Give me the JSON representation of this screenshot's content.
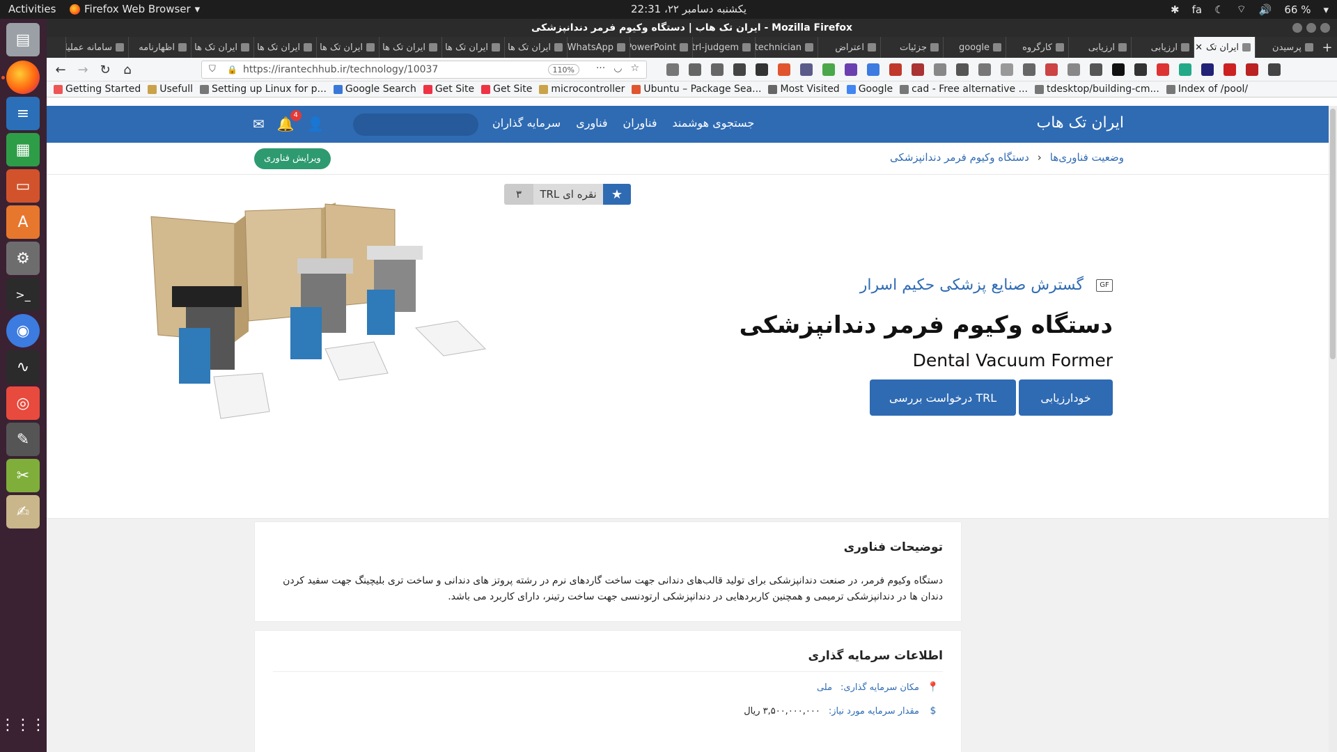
{
  "os": {
    "activities": "Activities",
    "app_name": "Firefox Web Browser",
    "clock": "یکشنبه دسامبر ۲۲، 22:31",
    "lang": "fa",
    "battery": "66 %"
  },
  "browser": {
    "window_title": "ایران تک هاب | دستگاه وکیوم فرمر دندانپزشکی - Mozilla Firefox",
    "tabs": [
      {
        "label": "پرسیدن"
      },
      {
        "label": "ایران تک",
        "active": true
      },
      {
        "label": "ارزیابی"
      },
      {
        "label": "ارزیابی"
      },
      {
        "label": "کارگروه"
      },
      {
        "label": "google"
      },
      {
        "label": "جزئیات"
      },
      {
        "label": "اعتراض"
      },
      {
        "label": "technician"
      },
      {
        "label": "trl-judgem"
      },
      {
        "label": "PowerPoint"
      },
      {
        "label": "WhatsApp"
      },
      {
        "label": "ایران تک ها"
      },
      {
        "label": "ایران تک ها"
      },
      {
        "label": "ایران تک ها"
      },
      {
        "label": "ایران تک ها"
      },
      {
        "label": "ایران تک ها"
      },
      {
        "label": "ایران تک ها"
      },
      {
        "label": "اظهارنامه"
      },
      {
        "label": "سامانه عملیا"
      }
    ],
    "url": "https://irantechhub.ir/technology/10037",
    "zoom": "110%",
    "bookmarks": [
      "Getting Started",
      "Usefull",
      "Setting up Linux for p...",
      "Google Search",
      "Get Site",
      "Get Site",
      "microcontroller",
      "Ubuntu – Package Sea...",
      "Most Visited",
      "Google",
      "cad - Free alternative ...",
      "tdesktop/building-cm...",
      "Index of /pool/"
    ]
  },
  "site": {
    "logo": "ایران تک هاب",
    "nav": [
      "جستجوی هوشمند",
      "فناوران",
      "فناوری",
      "سرمایه گذاران"
    ],
    "notifications": "4",
    "breadcrumb": [
      "وضعیت فناوری‌ها",
      "دستگاه وکیوم فرمر دندانپزشکی"
    ],
    "edit_button": "ویرایش فناوری",
    "trl": {
      "label": "TRL نقره ای",
      "value": "۳"
    },
    "company": "گسترش صنایع پزشکی حکیم اسرار",
    "title_fa": "دستگاه وکیوم فرمر دندانپزشکی",
    "title_en": "Dental Vacuum Former",
    "btn_self_assess": "خودارزیابی",
    "btn_trl_request": "درخواست بررسی TRL",
    "desc_title": "توضیحات فناوری",
    "desc_body": "دستگاه وکیوم فرمر، در صنعت دندانپزشکی برای تولید قالب‌های دندانی جهت ساخت گاردهای نرم در رشته پروتز های دندانی و ساخت تری بلیچینگ جهت سفید کردن دندان ها در دندانپزشکی ترمیمی و همچنین کاربردهایی در دندانپزشکی ارتودنسی جهت ساخت رتینر، دارای کاربرد می باشد.",
    "invest_title": "اطلاعات سرمایه گذاری",
    "invest_location_label": "مکان سرمایه گذاری:",
    "invest_location_value": "ملی",
    "invest_amount_label": "مقدار سرمایه مورد نیاز:",
    "invest_amount_value": "۳,۵۰۰,۰۰۰,۰۰۰ ریال"
  }
}
